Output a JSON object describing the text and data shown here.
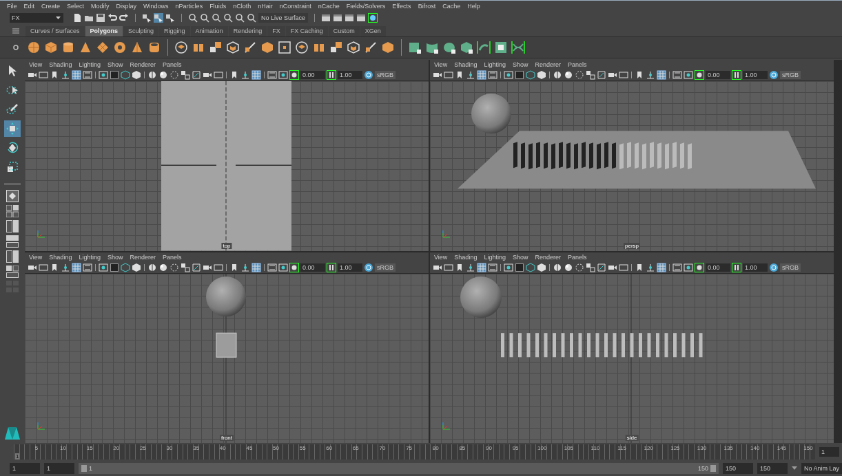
{
  "menu_bar": [
    "File",
    "Edit",
    "Create",
    "Select",
    "Modify",
    "Display",
    "Windows",
    "nParticles",
    "Fluids",
    "nCloth",
    "nHair",
    "nConstraint",
    "nCache",
    "Fields/Solvers",
    "Effects",
    "Bifrost",
    "Cache",
    "Help"
  ],
  "status_line": {
    "menu_set": "FX",
    "live_surface": "No Live Surface"
  },
  "shelf_tabs": [
    {
      "label": "Curves / Surfaces",
      "selected": false
    },
    {
      "label": "Polygons",
      "selected": true
    },
    {
      "label": "Sculpting",
      "selected": false
    },
    {
      "label": "Rigging",
      "selected": false
    },
    {
      "label": "Animation",
      "selected": false
    },
    {
      "label": "Rendering",
      "selected": false
    },
    {
      "label": "FX",
      "selected": false
    },
    {
      "label": "FX Caching",
      "selected": false
    },
    {
      "label": "Custom",
      "selected": false
    },
    {
      "label": "XGen",
      "selected": false
    }
  ],
  "tools": [
    {
      "selected": false
    },
    {
      "selected": false
    },
    {
      "selected": false
    },
    {
      "selected": true
    },
    {
      "selected": false
    },
    {
      "selected": false
    }
  ],
  "viewports": [
    {
      "label": "top",
      "menu": [
        "View",
        "Shading",
        "Lighting",
        "Show",
        "Renderer",
        "Panels"
      ],
      "exposure": "0.00",
      "gamma": "1.00",
      "color_space": "sRGB"
    },
    {
      "label": "persp",
      "menu": [
        "View",
        "Shading",
        "Lighting",
        "Show",
        "Renderer",
        "Panels"
      ],
      "exposure": "0.00",
      "gamma": "1.00",
      "color_space": "sRGB"
    },
    {
      "label": "front",
      "menu": [
        "View",
        "Shading",
        "Lighting",
        "Show",
        "Renderer",
        "Panels"
      ],
      "exposure": "0.00",
      "gamma": "1.00",
      "color_space": "sRGB"
    },
    {
      "label": "side",
      "menu": [
        "View",
        "Shading",
        "Lighting",
        "Show",
        "Renderer",
        "Panels"
      ],
      "exposure": "0.00",
      "gamma": "1.00",
      "color_space": "sRGB"
    }
  ],
  "time_slider": {
    "first_frame": "1",
    "level": 0,
    "labels": [
      "5",
      "10",
      "15",
      "20",
      "25",
      "30",
      "35",
      "40",
      "45",
      "50",
      "55",
      "60",
      "65",
      "70",
      "75",
      "80",
      "85",
      "90",
      "95",
      "100",
      "105",
      "110",
      "115",
      "120",
      "125",
      "130",
      "135",
      "140",
      "145",
      "150"
    ],
    "current_frame": "1"
  },
  "range_slider": {
    "level": 1,
    "start": "1",
    "playback_start": "1",
    "range_start": "1",
    "range_end": "150",
    "playback_end": "150",
    "end": "150",
    "anim_layer": "No Anim Lay"
  }
}
